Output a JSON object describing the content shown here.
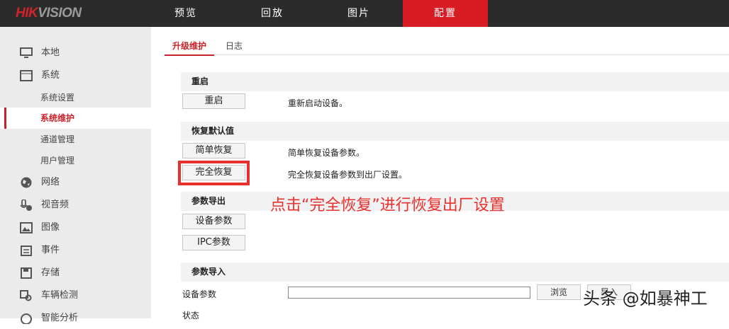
{
  "header": {
    "logo_red": "HIK",
    "logo_gray": "VISION",
    "nav": [
      "预览",
      "回放",
      "图片",
      "配置"
    ]
  },
  "sidebar": {
    "items": [
      {
        "label": "本地",
        "icon": "monitor-icon"
      },
      {
        "label": "系统",
        "icon": "window-icon"
      },
      {
        "label": "系统设置"
      },
      {
        "label": "系统维护"
      },
      {
        "label": "通道管理"
      },
      {
        "label": "用户管理"
      },
      {
        "label": "网络",
        "icon": "globe-icon"
      },
      {
        "label": "视音频",
        "icon": "microphone-icon"
      },
      {
        "label": "图像",
        "icon": "image-icon"
      },
      {
        "label": "事件",
        "icon": "calendar-icon"
      },
      {
        "label": "存储",
        "icon": "floppy-icon"
      },
      {
        "label": "车辆检测",
        "icon": "vehicle-search-icon"
      },
      {
        "label": "智能分析",
        "icon": "analysis-icon"
      }
    ]
  },
  "tabs": [
    "升级维护",
    "日志"
  ],
  "reboot": {
    "title": "重启",
    "button": "重启",
    "desc": "重新启动设备。"
  },
  "restore": {
    "title": "恢复默认值",
    "simple_button": "简单恢复",
    "simple_desc": "简单恢复设备参数。",
    "full_button": "完全恢复",
    "full_desc": "完全恢复设备参数到出厂设置。"
  },
  "export": {
    "title": "参数导出",
    "device_button": "设备参数",
    "ipc_button": "IPC参数"
  },
  "import": {
    "title": "参数导入",
    "label": "设备参数",
    "file_value": "",
    "browse": "浏览",
    "import_button": "导入",
    "status_label": "状态"
  },
  "annotation": "点击“完全恢复”进行恢复出厂设置",
  "watermark": "头条 @如暴神工"
}
